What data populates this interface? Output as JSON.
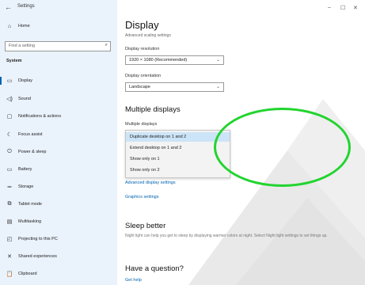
{
  "window": {
    "title": "Settings",
    "controls": [
      "–",
      "☐",
      "✕"
    ]
  },
  "sidebar": {
    "home": "Home",
    "search_placeholder": "Find a setting",
    "section": "System",
    "items": [
      {
        "label": "Display",
        "icon": "monitor-icon"
      },
      {
        "label": "Sound",
        "icon": "speaker-icon"
      },
      {
        "label": "Notifications & actions",
        "icon": "notifications-icon"
      },
      {
        "label": "Focus assist",
        "icon": "moon-icon"
      },
      {
        "label": "Power & sleep",
        "icon": "power-icon"
      },
      {
        "label": "Battery",
        "icon": "battery-icon"
      },
      {
        "label": "Storage",
        "icon": "storage-icon"
      },
      {
        "label": "Tablet mode",
        "icon": "tablet-icon"
      },
      {
        "label": "Multitasking",
        "icon": "multitasking-icon"
      },
      {
        "label": "Projecting to this PC",
        "icon": "projector-icon"
      },
      {
        "label": "Shared experiences",
        "icon": "shared-icon"
      },
      {
        "label": "Clipboard",
        "icon": "clipboard-icon"
      }
    ]
  },
  "main": {
    "title": "Display",
    "cutoff_text": "Advanced scaling settings",
    "resolution": {
      "label": "Display resolution",
      "value": "1920 × 1080 (Recommended)"
    },
    "orientation": {
      "label": "Display orientation",
      "value": "Landscape"
    },
    "multiple_displays": {
      "heading": "Multiple displays",
      "label": "Multiple displays",
      "options": [
        "Duplicate desktop on 1 and 2",
        "Extend desktop on 1 and 2",
        "Show only on 1",
        "Show only on 2"
      ],
      "selected": "Duplicate desktop on 1 and 2"
    },
    "advanced_link": "Advanced display settings",
    "graphics_link": "Graphics settings",
    "sleep": {
      "heading": "Sleep better",
      "text": "Night light can help you get to sleep by displaying warmer colors at night. Select Night light settings to set things up."
    },
    "question": {
      "heading": "Have a question?",
      "link": "Get help"
    }
  },
  "colors": {
    "accent": "#0063b1",
    "highlight_ring": "#22d42e",
    "sidebar_bg": "#eaf2fb"
  }
}
